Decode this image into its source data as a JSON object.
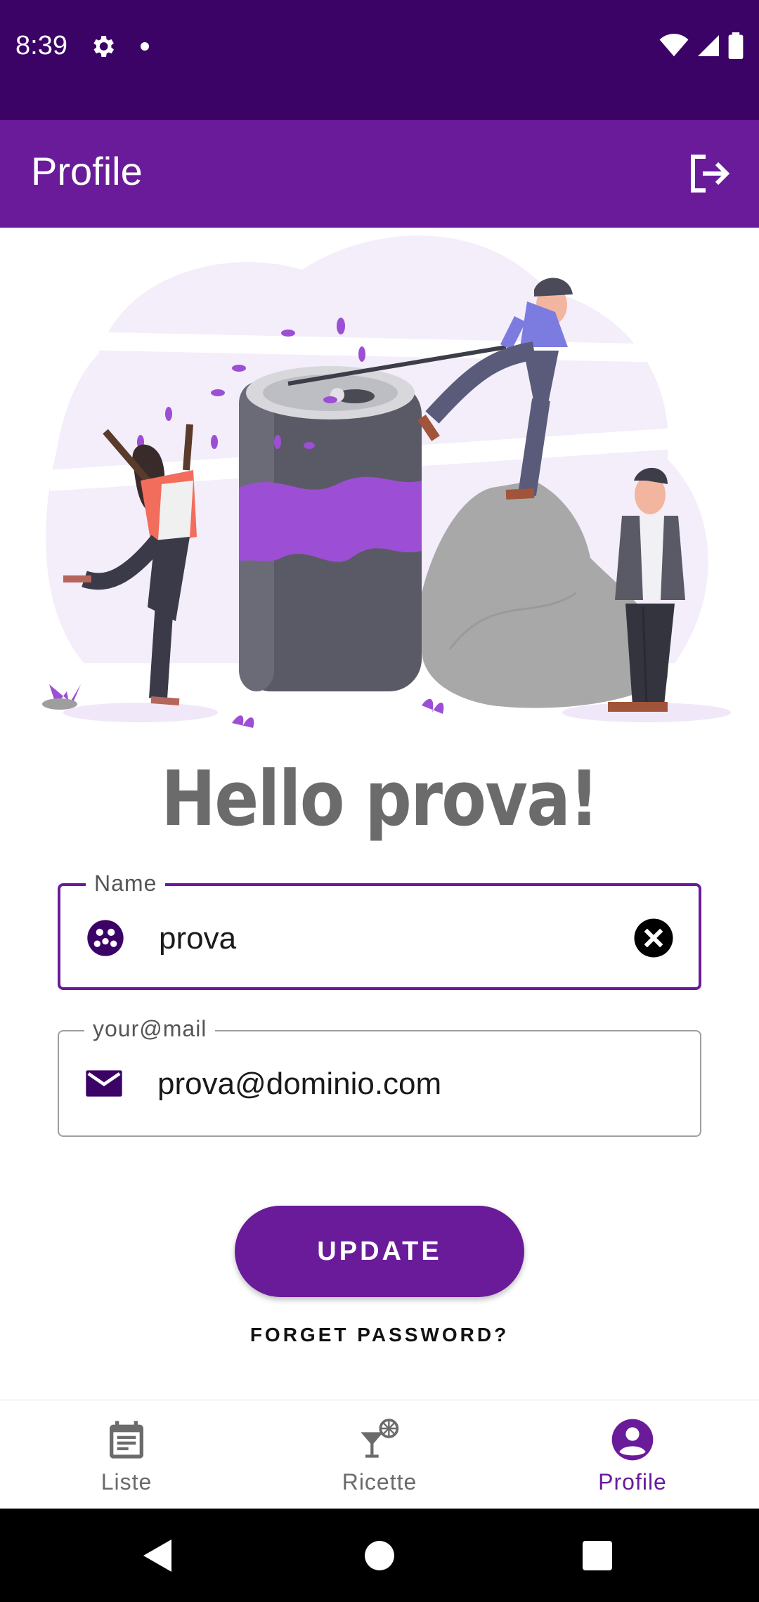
{
  "status_bar": {
    "time": "8:39"
  },
  "app_bar": {
    "title": "Profile"
  },
  "greeting": "Hello prova!",
  "form": {
    "name": {
      "label": "Name",
      "value": "prova"
    },
    "email": {
      "label": "your@mail",
      "value": "prova@dominio.com"
    },
    "update_label": "UPDATE",
    "forget_label": "FORGET PASSWORD?"
  },
  "bottom_nav": {
    "items": [
      {
        "label": "Liste",
        "icon": "calendar-list-icon",
        "active": false
      },
      {
        "label": "Ricette",
        "icon": "cocktail-icon",
        "active": false
      },
      {
        "label": "Profile",
        "icon": "account-circle-icon",
        "active": true
      }
    ]
  },
  "colors": {
    "status_bar": "#3b0366",
    "primary": "#6a1b9a",
    "accent_purple": "#9c4fd4",
    "greeting_gray": "#6b6b6b"
  }
}
